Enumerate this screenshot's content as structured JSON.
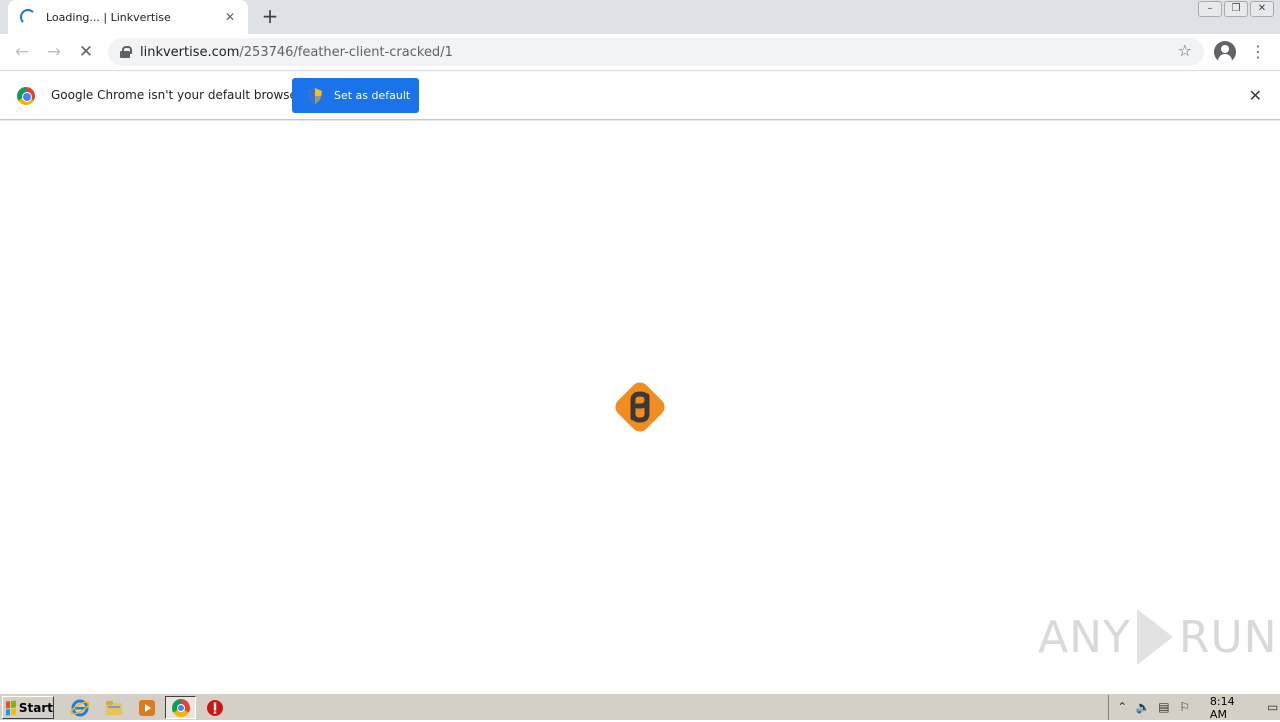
{
  "browser": {
    "tab": {
      "title": "Loading... | Linkvertise",
      "close_icon": "close-icon"
    },
    "new_tab_label": "+",
    "toolbar": {
      "url_host": "linkvertise.com",
      "url_path": "/253746/feather-client-cracked/1"
    },
    "infobar": {
      "message": "Google Chrome isn't your default browser",
      "button_label": "Set as default"
    }
  },
  "page": {
    "state": "loading",
    "logo": "linkvertise-logo",
    "brand_color": "#f28c1e"
  },
  "watermark": {
    "text_left": "ANY",
    "text_right": "RUN"
  },
  "taskbar": {
    "start_label": "Start",
    "clock": "8:14 AM",
    "pinned": [
      "internet-explorer-icon",
      "folder-icon",
      "media-player-icon",
      "chrome-icon",
      "stop-icon"
    ]
  },
  "colors": {
    "accent": "#1a73e8",
    "tabstrip": "#dee1e6",
    "taskbar": "#d4d0c8"
  }
}
